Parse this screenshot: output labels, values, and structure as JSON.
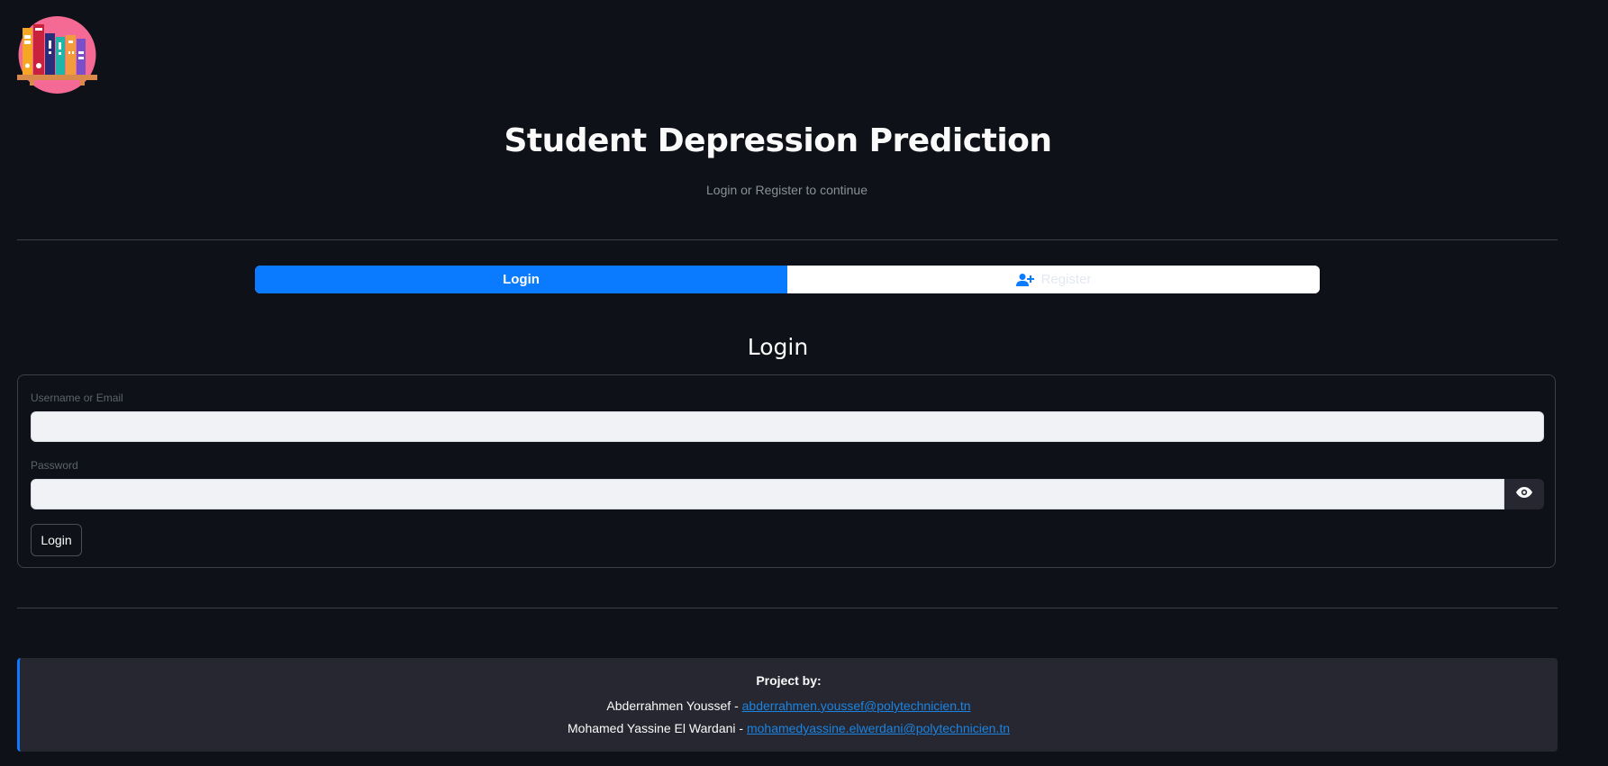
{
  "header": {
    "title": "Student Depression Prediction",
    "subtitle": "Login or Register to continue"
  },
  "tabs": [
    {
      "label": "Login",
      "active": true
    },
    {
      "label": "Register",
      "active": false,
      "icon": "user-plus-icon"
    }
  ],
  "login_form": {
    "heading": "Login",
    "username_label": "Username or Email",
    "username_value": "",
    "password_label": "Password",
    "password_value": "",
    "submit_label": "Login",
    "toggle_icon": "eye-icon"
  },
  "footer": {
    "heading": "Project by:",
    "authors": [
      {
        "name": "Abderrahmen Youssef - ",
        "email": "abderrahmen.youssef@polytechnicien.tn"
      },
      {
        "name": "Mohamed Yassine El Wardani - ",
        "email": "mohamedyassine.elwerdani@polytechnicien.tn"
      }
    ]
  },
  "colors": {
    "background": "#0e1117",
    "accent": "#0a7bff",
    "link": "#1c83e1",
    "panel": "#262730"
  }
}
